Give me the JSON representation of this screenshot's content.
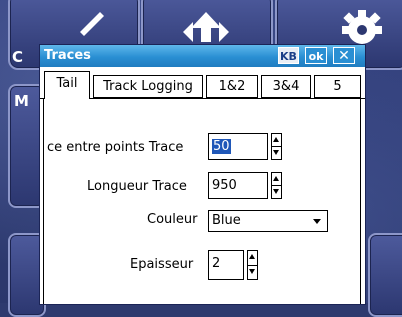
{
  "background": {
    "tiles": [
      {
        "icon": "pencil-icon",
        "label": "C"
      },
      {
        "icon": "upload-arrows-icon",
        "label": ""
      },
      {
        "icon": "gear-icon",
        "label": ""
      },
      {
        "icon": "",
        "label": "M"
      }
    ]
  },
  "dialog": {
    "title": "Traces",
    "kb_label": "KB",
    "ok_label": "ok",
    "close_label": "✕",
    "tabs": [
      {
        "label": "Tail",
        "active": true
      },
      {
        "label": "Track Logging",
        "active": false
      },
      {
        "label": "1&2",
        "active": false
      },
      {
        "label": "3&4",
        "active": false
      },
      {
        "label": "5",
        "active": false
      }
    ],
    "fields": {
      "distance": {
        "label": "ce entre points Trace",
        "value": "50"
      },
      "length": {
        "label": "Longueur Trace",
        "value": "950"
      },
      "color": {
        "label": "Couleur",
        "value": "Blue"
      },
      "thickness": {
        "label": "Epaisseur",
        "value": "2"
      }
    }
  },
  "colors": {
    "titlebar": "#2a8fd3",
    "selection": "#1f57b8"
  }
}
